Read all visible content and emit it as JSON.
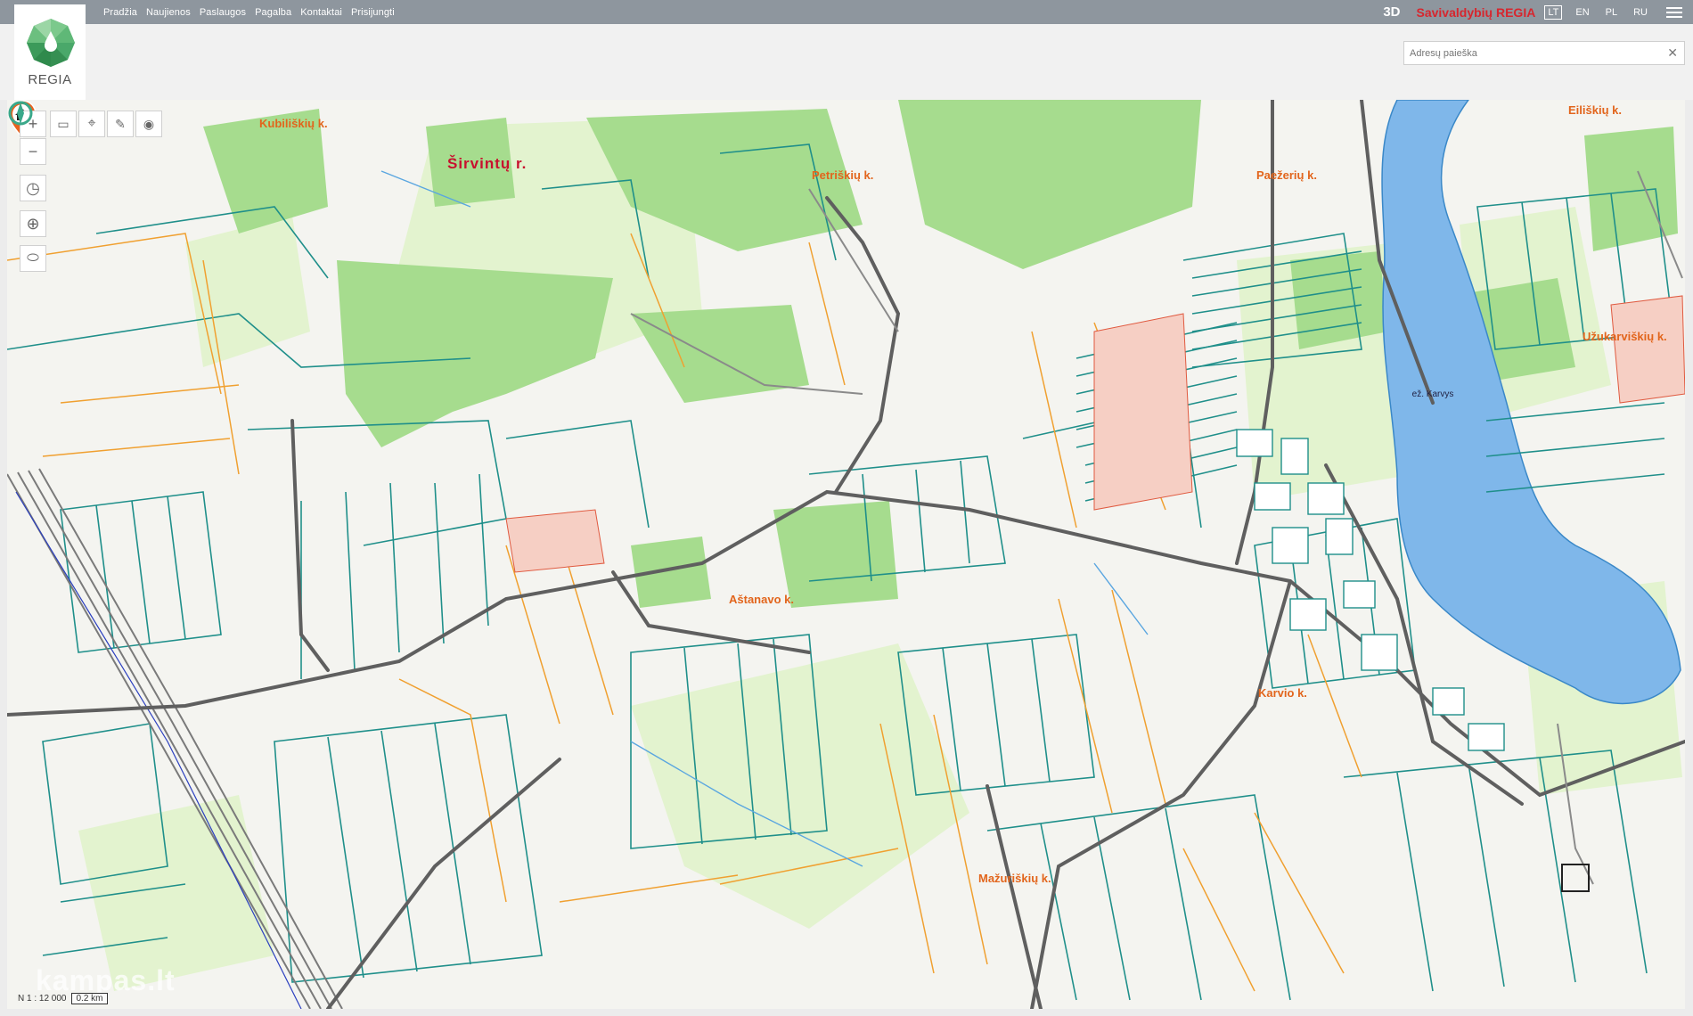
{
  "topbar": {
    "nav": [
      "Pradžia",
      "Naujienos",
      "Paslaugos",
      "Pagalba",
      "Kontaktai",
      "Prisijungti"
    ],
    "mode_3d": "3D",
    "brand": "Savivaldybių REGIA",
    "languages": [
      "LT",
      "EN",
      "PL",
      "RU"
    ],
    "active_language": "LT",
    "menu_icon": "hamburger-icon"
  },
  "logo": {
    "text": "REGIA",
    "icon": "regia-logo-icon"
  },
  "search": {
    "placeholder": "Adresų paieška",
    "value": "",
    "clear_icon": "close-icon"
  },
  "map": {
    "tools": [
      {
        "name": "zoom-in-button",
        "glyph": "+"
      },
      {
        "name": "zoom-out-button",
        "glyph": "−"
      },
      {
        "name": "measure-button",
        "glyph": "▭"
      },
      {
        "name": "marker-button",
        "glyph": "⌖"
      },
      {
        "name": "edit-button",
        "glyph": "✎"
      },
      {
        "name": "target-button",
        "glyph": "◉"
      },
      {
        "name": "history-button",
        "glyph": "◷"
      },
      {
        "name": "locate-button",
        "glyph": "⊕"
      },
      {
        "name": "select-area-button",
        "glyph": "⬭"
      }
    ],
    "places": [
      "Kubiliškių k.",
      "Širvintų r.",
      "Petriškių k.",
      "Paežerių k.",
      "Eiliškių k.",
      "Užukarviškių k.",
      "Aštanavo k.",
      "Karvio k.",
      "Mažuriškių k."
    ],
    "lake_label": "ež. Karvys",
    "scale_ratio": "N 1 : 12 000",
    "scale_bar": "0.2 km",
    "watermark": "kampas.lt",
    "colors": {
      "parcel_teal": "#1f8f8a",
      "parcel_orange": "#f0a030",
      "forest": "#a6dc8e",
      "forest_light": "#d6efb7",
      "road": "#6d6d6d",
      "lake": "#7fb7ea",
      "place_label": "#e2651c",
      "district_label": "#c8102e",
      "pin": "#e8621e"
    }
  }
}
